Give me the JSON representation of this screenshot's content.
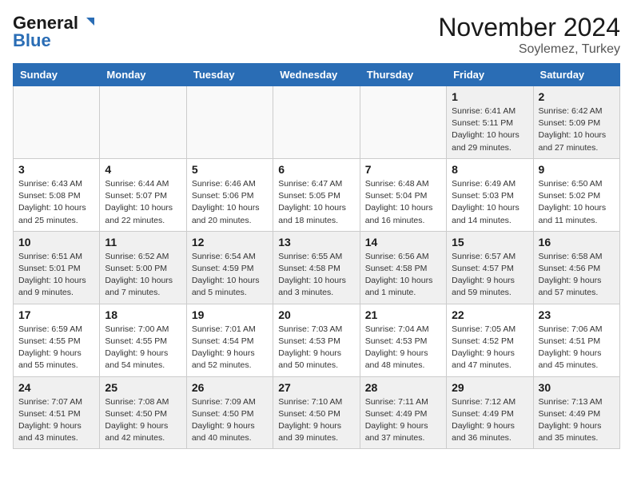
{
  "header": {
    "logo_line1": "General",
    "logo_line2": "Blue",
    "month": "November 2024",
    "location": "Soylemez, Turkey"
  },
  "weekdays": [
    "Sunday",
    "Monday",
    "Tuesday",
    "Wednesday",
    "Thursday",
    "Friday",
    "Saturday"
  ],
  "weeks": [
    [
      {
        "day": "",
        "text": "",
        "empty": true
      },
      {
        "day": "",
        "text": "",
        "empty": true
      },
      {
        "day": "",
        "text": "",
        "empty": true
      },
      {
        "day": "",
        "text": "",
        "empty": true
      },
      {
        "day": "",
        "text": "",
        "empty": true
      },
      {
        "day": "1",
        "text": "Sunrise: 6:41 AM\nSunset: 5:11 PM\nDaylight: 10 hours\nand 29 minutes.",
        "empty": false
      },
      {
        "day": "2",
        "text": "Sunrise: 6:42 AM\nSunset: 5:09 PM\nDaylight: 10 hours\nand 27 minutes.",
        "empty": false
      }
    ],
    [
      {
        "day": "3",
        "text": "Sunrise: 6:43 AM\nSunset: 5:08 PM\nDaylight: 10 hours\nand 25 minutes.",
        "empty": false
      },
      {
        "day": "4",
        "text": "Sunrise: 6:44 AM\nSunset: 5:07 PM\nDaylight: 10 hours\nand 22 minutes.",
        "empty": false
      },
      {
        "day": "5",
        "text": "Sunrise: 6:46 AM\nSunset: 5:06 PM\nDaylight: 10 hours\nand 20 minutes.",
        "empty": false
      },
      {
        "day": "6",
        "text": "Sunrise: 6:47 AM\nSunset: 5:05 PM\nDaylight: 10 hours\nand 18 minutes.",
        "empty": false
      },
      {
        "day": "7",
        "text": "Sunrise: 6:48 AM\nSunset: 5:04 PM\nDaylight: 10 hours\nand 16 minutes.",
        "empty": false
      },
      {
        "day": "8",
        "text": "Sunrise: 6:49 AM\nSunset: 5:03 PM\nDaylight: 10 hours\nand 14 minutes.",
        "empty": false
      },
      {
        "day": "9",
        "text": "Sunrise: 6:50 AM\nSunset: 5:02 PM\nDaylight: 10 hours\nand 11 minutes.",
        "empty": false
      }
    ],
    [
      {
        "day": "10",
        "text": "Sunrise: 6:51 AM\nSunset: 5:01 PM\nDaylight: 10 hours\nand 9 minutes.",
        "empty": false
      },
      {
        "day": "11",
        "text": "Sunrise: 6:52 AM\nSunset: 5:00 PM\nDaylight: 10 hours\nand 7 minutes.",
        "empty": false
      },
      {
        "day": "12",
        "text": "Sunrise: 6:54 AM\nSunset: 4:59 PM\nDaylight: 10 hours\nand 5 minutes.",
        "empty": false
      },
      {
        "day": "13",
        "text": "Sunrise: 6:55 AM\nSunset: 4:58 PM\nDaylight: 10 hours\nand 3 minutes.",
        "empty": false
      },
      {
        "day": "14",
        "text": "Sunrise: 6:56 AM\nSunset: 4:58 PM\nDaylight: 10 hours\nand 1 minute.",
        "empty": false
      },
      {
        "day": "15",
        "text": "Sunrise: 6:57 AM\nSunset: 4:57 PM\nDaylight: 9 hours\nand 59 minutes.",
        "empty": false
      },
      {
        "day": "16",
        "text": "Sunrise: 6:58 AM\nSunset: 4:56 PM\nDaylight: 9 hours\nand 57 minutes.",
        "empty": false
      }
    ],
    [
      {
        "day": "17",
        "text": "Sunrise: 6:59 AM\nSunset: 4:55 PM\nDaylight: 9 hours\nand 55 minutes.",
        "empty": false
      },
      {
        "day": "18",
        "text": "Sunrise: 7:00 AM\nSunset: 4:55 PM\nDaylight: 9 hours\nand 54 minutes.",
        "empty": false
      },
      {
        "day": "19",
        "text": "Sunrise: 7:01 AM\nSunset: 4:54 PM\nDaylight: 9 hours\nand 52 minutes.",
        "empty": false
      },
      {
        "day": "20",
        "text": "Sunrise: 7:03 AM\nSunset: 4:53 PM\nDaylight: 9 hours\nand 50 minutes.",
        "empty": false
      },
      {
        "day": "21",
        "text": "Sunrise: 7:04 AM\nSunset: 4:53 PM\nDaylight: 9 hours\nand 48 minutes.",
        "empty": false
      },
      {
        "day": "22",
        "text": "Sunrise: 7:05 AM\nSunset: 4:52 PM\nDaylight: 9 hours\nand 47 minutes.",
        "empty": false
      },
      {
        "day": "23",
        "text": "Sunrise: 7:06 AM\nSunset: 4:51 PM\nDaylight: 9 hours\nand 45 minutes.",
        "empty": false
      }
    ],
    [
      {
        "day": "24",
        "text": "Sunrise: 7:07 AM\nSunset: 4:51 PM\nDaylight: 9 hours\nand 43 minutes.",
        "empty": false
      },
      {
        "day": "25",
        "text": "Sunrise: 7:08 AM\nSunset: 4:50 PM\nDaylight: 9 hours\nand 42 minutes.",
        "empty": false
      },
      {
        "day": "26",
        "text": "Sunrise: 7:09 AM\nSunset: 4:50 PM\nDaylight: 9 hours\nand 40 minutes.",
        "empty": false
      },
      {
        "day": "27",
        "text": "Sunrise: 7:10 AM\nSunset: 4:50 PM\nDaylight: 9 hours\nand 39 minutes.",
        "empty": false
      },
      {
        "day": "28",
        "text": "Sunrise: 7:11 AM\nSunset: 4:49 PM\nDaylight: 9 hours\nand 37 minutes.",
        "empty": false
      },
      {
        "day": "29",
        "text": "Sunrise: 7:12 AM\nSunset: 4:49 PM\nDaylight: 9 hours\nand 36 minutes.",
        "empty": false
      },
      {
        "day": "30",
        "text": "Sunrise: 7:13 AM\nSunset: 4:49 PM\nDaylight: 9 hours\nand 35 minutes.",
        "empty": false
      }
    ]
  ]
}
